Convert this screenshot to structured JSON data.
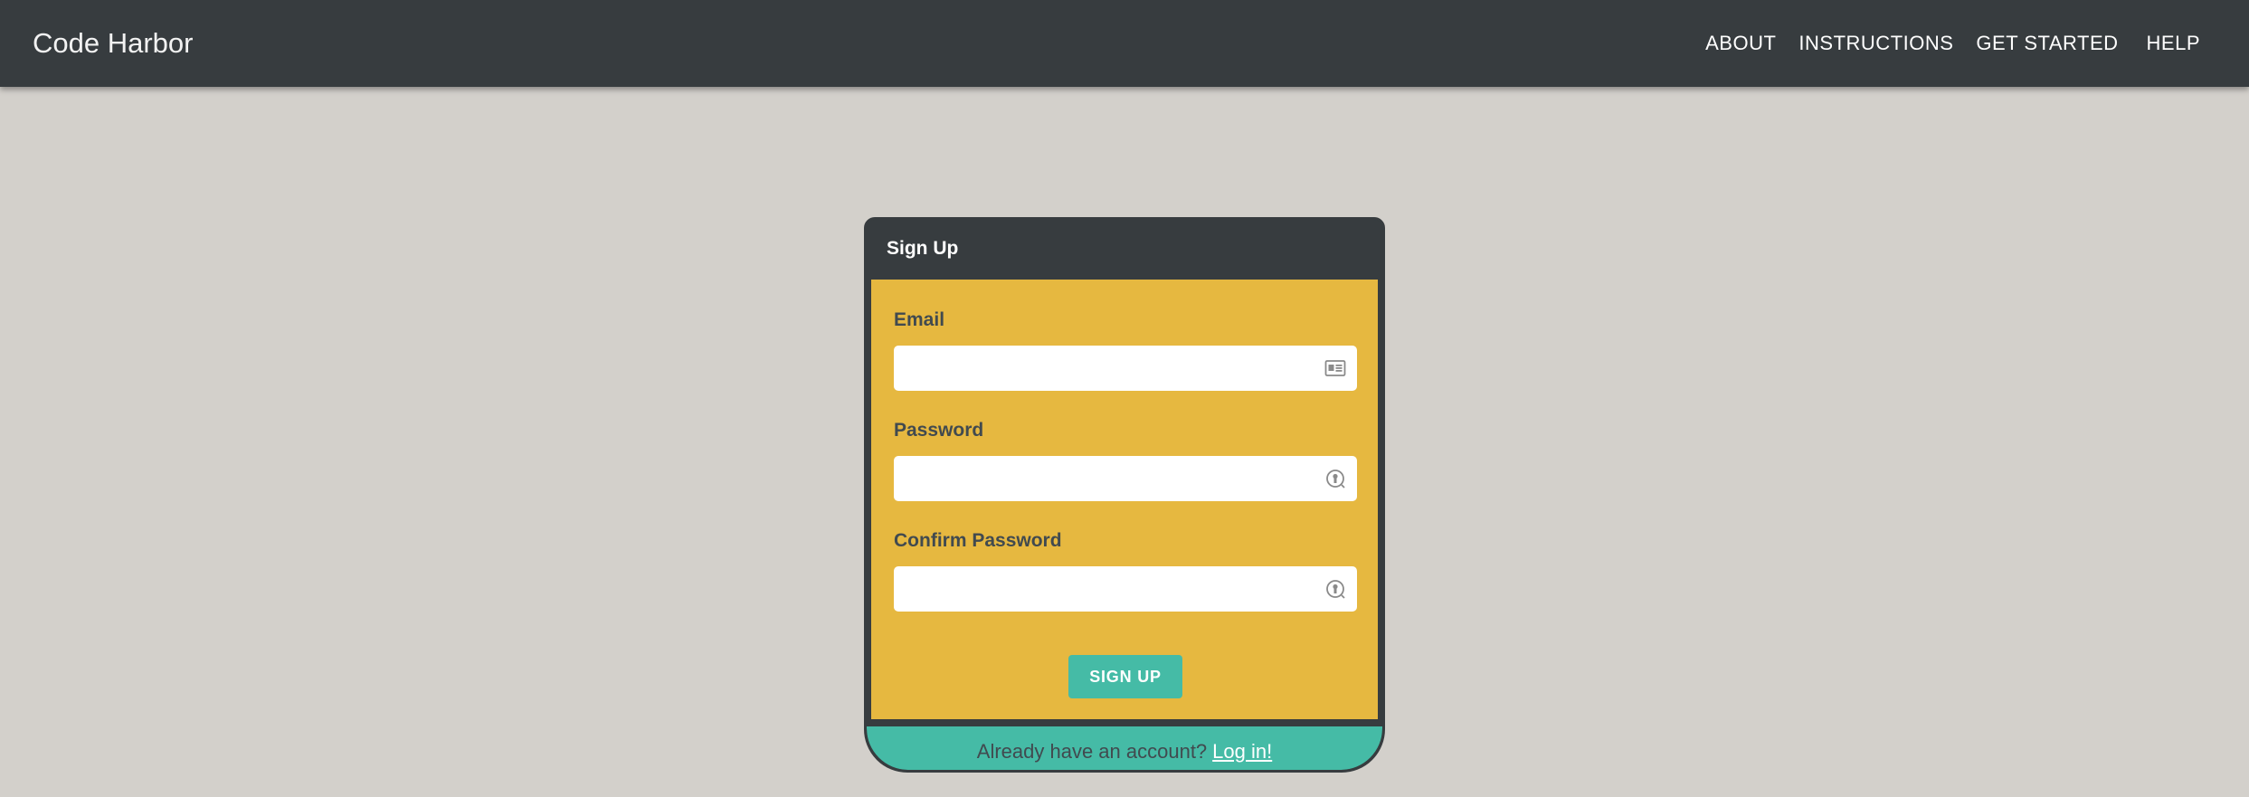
{
  "navbar": {
    "brand": "Code Harbor",
    "links": [
      "ABOUT",
      "INSTRUCTIONS",
      "GET STARTED",
      "HELP"
    ]
  },
  "signup": {
    "title": "Sign Up",
    "fields": [
      {
        "label": "Email",
        "value": "",
        "icon": "id-card-icon"
      },
      {
        "label": "Password",
        "value": "",
        "icon": "password-key-icon"
      },
      {
        "label": "Confirm Password",
        "value": "",
        "icon": "password-key-icon"
      }
    ],
    "button_label": "SIGN UP",
    "footer_text": "Already have an account?",
    "login_link": "Log in!"
  },
  "colors": {
    "navbar": "#373c3f",
    "page_background": "#d3d0cb",
    "form_body": "#e6b840",
    "accent_teal": "#45bba6"
  }
}
